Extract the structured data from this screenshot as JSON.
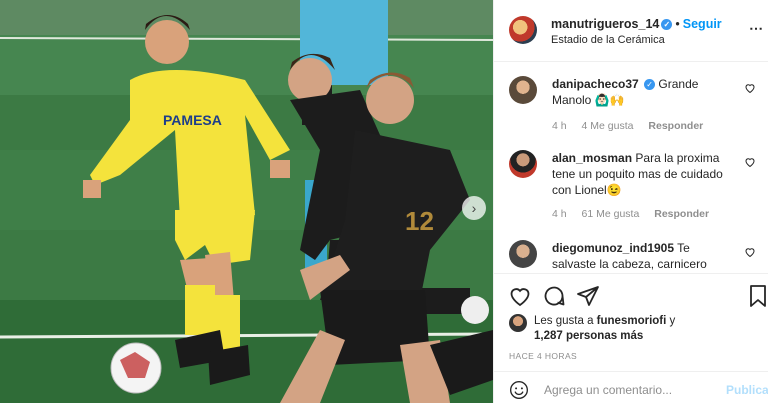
{
  "post": {
    "username": "manutrigueros_14",
    "separator": "•",
    "follow_label": "Seguir",
    "location": "Estadio de la Cerámica",
    "more_icon": "more-horizontal-icon"
  },
  "photo": {
    "description_icon": "football-photo",
    "next_icon": "chevron-right-icon",
    "sponsor_text": "PAMESA",
    "colors": {
      "pitch": "#3c7a44",
      "yellow_kit": "#f4e33c",
      "black_kit": "#1c1c1c"
    }
  },
  "comments": [
    {
      "username": "danipacheco37",
      "verified": true,
      "text": "Grande Manolo 🙆🏻‍♂️🙌",
      "time": "4 h",
      "likes": "4 Me gusta",
      "reply": "Responder"
    },
    {
      "username": "alan_mosman",
      "verified": false,
      "text": "Para la proxima tene un poquito mas de cuidado con Lionel😉",
      "time": "4 h",
      "likes": "61 Me gusta",
      "reply": "Responder"
    },
    {
      "username": "diegomunoz_ind1905",
      "verified": false,
      "text": "Te salvaste la cabeza, carnicero afortunado"
    }
  ],
  "actions": {
    "icons": [
      "heart-icon",
      "comment-icon",
      "share-icon",
      "bookmark-icon"
    ],
    "likes_prefix": "Les gusta a",
    "likes_user": "funesmoriofi",
    "likes_mid": "y",
    "likes_count": "1,287 personas más",
    "time_ago": "HACE 4 HORAS"
  },
  "comment_box": {
    "placeholder": "Agrega un comentario...",
    "publish_label": "Publicar"
  }
}
